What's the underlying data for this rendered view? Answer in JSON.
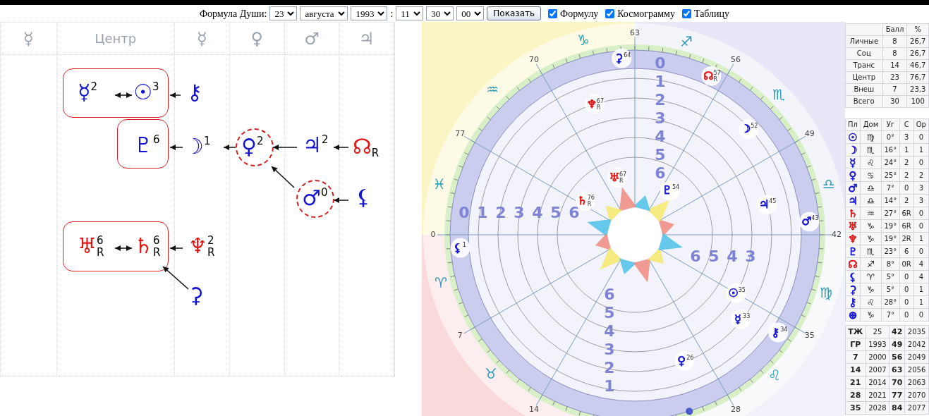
{
  "toolbar": {
    "label": "Формула Души:",
    "day": "23",
    "month": "августа",
    "year": "1993",
    "separator": ":",
    "hour": "11",
    "minute": "30",
    "second": "00",
    "button": "Показать",
    "checkboxes": [
      {
        "label": "Формулу",
        "checked": true
      },
      {
        "label": "Космограмму",
        "checked": true
      },
      {
        "label": "Таблицу",
        "checked": true
      }
    ]
  },
  "formula": {
    "columns": [
      {
        "label": "☿",
        "kind": "glyph"
      },
      {
        "label": "Центр",
        "kind": "text"
      },
      {
        "label": "☿",
        "kind": "glyph"
      },
      {
        "label": "♀",
        "kind": "glyph"
      },
      {
        "label": "♂",
        "kind": "glyph"
      },
      {
        "label": "♃",
        "kind": "glyph"
      }
    ],
    "groups": [
      {
        "nodes": [
          {
            "glyph": "☿",
            "sup": "2",
            "color": "#1414d2",
            "circled": false
          },
          {
            "glyph": "☉",
            "sup": "3",
            "color": "#1414d2",
            "circled": false
          }
        ]
      },
      {
        "nodes": [
          {
            "glyph": "♇",
            "sup": "6",
            "color": "#1414d2",
            "circled": false
          }
        ]
      },
      {
        "nodes": [
          {
            "glyph": "♅",
            "sup": "6",
            "sub": "R",
            "color": "#e31414",
            "circled": false
          },
          {
            "glyph": "♄",
            "sup": "6",
            "sub": "R",
            "color": "#e31414",
            "circled": false
          }
        ]
      }
    ],
    "nodes": [
      {
        "glyph": "⚷",
        "color": "#1414d2",
        "circled": false
      },
      {
        "glyph": "☽",
        "sup": "1",
        "color": "#1414d2",
        "circled": false
      },
      {
        "glyph": "♀",
        "sup": "2",
        "color": "#1414d2",
        "circled": true
      },
      {
        "glyph": "♃",
        "sup": "2",
        "color": "#1414d2",
        "circled": false
      },
      {
        "glyph": "☊",
        "sub": "R",
        "color": "#e31414",
        "circled": false
      },
      {
        "glyph": "♂",
        "sup": "0",
        "color": "#1414d2",
        "circled": true
      },
      {
        "glyph": "⚸",
        "color": "#1414d2",
        "circled": false
      },
      {
        "glyph": "♆",
        "sup": "2",
        "sub": "R",
        "color": "#e31414",
        "circled": false
      },
      {
        "glyph": "⚳",
        "color": "#1414d2",
        "circled": false
      }
    ]
  },
  "cosmogram": {
    "ages": [
      "0",
      "7",
      "14",
      "28",
      "35",
      "42",
      "49",
      "56",
      "63",
      "70",
      "77"
    ],
    "signs": [
      "♑",
      "♐",
      "♏",
      "♎",
      "♍",
      "♌",
      "♉",
      "♈",
      "♓",
      "♒"
    ],
    "scales": [
      {
        "labels": [
          "0",
          "1",
          "2",
          "3",
          "4",
          "5",
          "6"
        ]
      },
      {
        "labels": [
          "0",
          "1",
          "2",
          "3",
          "4",
          "5",
          "6"
        ]
      },
      {
        "labels": [
          "6",
          "5",
          "4",
          "3"
        ]
      },
      {
        "labels": [
          "6",
          "5",
          "4",
          "3",
          "2",
          "1"
        ]
      }
    ],
    "planets": [
      {
        "glyph": "⚳",
        "age": "64",
        "color": "#1414d2"
      },
      {
        "glyph": "☊",
        "age": "57",
        "retro": "R",
        "color": "#e31414"
      },
      {
        "glyph": "☽",
        "age": "52",
        "color": "#1414d2"
      },
      {
        "glyph": "♆",
        "age": "67",
        "retro": "R",
        "color": "#e31414"
      },
      {
        "glyph": "♅",
        "age": "67",
        "retro": "R",
        "color": "#e31414"
      },
      {
        "glyph": "♄",
        "age": "76",
        "retro": "R",
        "color": "#e31414"
      },
      {
        "glyph": "♇",
        "age": "54",
        "color": "#1414d2"
      },
      {
        "glyph": "♃",
        "age": "45",
        "color": "#1414d2"
      },
      {
        "glyph": "♂",
        "age": "43",
        "color": "#1414d2"
      },
      {
        "glyph": "⚸",
        "age": "1",
        "color": "#1414d2"
      },
      {
        "glyph": "☉",
        "age": "35",
        "color": "#1414d2"
      },
      {
        "glyph": "☿",
        "age": "33",
        "color": "#1414d2"
      },
      {
        "glyph": "⚷",
        "age": "34",
        "color": "#1414d2"
      },
      {
        "glyph": "♀",
        "age": "26",
        "color": "#1414d2"
      }
    ]
  },
  "scores": {
    "columns": [
      "",
      "Балл",
      "%"
    ],
    "rows": [
      [
        "Личные",
        "8",
        "26,7"
      ],
      [
        "Соц",
        "8",
        "26,7"
      ],
      [
        "Транс",
        "14",
        "46,7"
      ],
      [
        "Центр",
        "23",
        "76,7"
      ],
      [
        "Внеш",
        "7",
        "23,3"
      ],
      [
        "Всего",
        "30",
        "100"
      ]
    ]
  },
  "planets_table": {
    "columns": [
      "Пл",
      "Дом",
      "Уг",
      "С",
      "Ор"
    ],
    "rows": [
      {
        "glyph": "☉",
        "color": "#1414d2",
        "sign": "♍",
        "deg": "0°",
        "c": "3",
        "or": "0"
      },
      {
        "glyph": "☽",
        "color": "#1414d2",
        "sign": "♏",
        "deg": "16°",
        "c": "1",
        "or": "1"
      },
      {
        "glyph": "☿",
        "color": "#1414d2",
        "sign": "♌",
        "deg": "24°",
        "c": "2",
        "or": "0"
      },
      {
        "glyph": "♀",
        "color": "#1414d2",
        "sign": "♋",
        "deg": "25°",
        "c": "2",
        "or": "2"
      },
      {
        "glyph": "♂",
        "color": "#1414d2",
        "sign": "♎",
        "deg": "7°",
        "c": "0",
        "or": "3"
      },
      {
        "glyph": "♃",
        "color": "#1414d2",
        "sign": "♎",
        "deg": "14°",
        "c": "2",
        "or": "3"
      },
      {
        "glyph": "♄",
        "color": "#e31414",
        "sign": "♒",
        "deg": "27°",
        "c": "6R",
        "or": "0"
      },
      {
        "glyph": "♅",
        "color": "#e31414",
        "sign": "♑",
        "deg": "19°",
        "c": "6R",
        "or": "0"
      },
      {
        "glyph": "♆",
        "color": "#e31414",
        "sign": "♑",
        "deg": "19°",
        "c": "2R",
        "or": "1"
      },
      {
        "glyph": "♇",
        "color": "#1414d2",
        "sign": "♏",
        "deg": "23°",
        "c": "6",
        "or": "0"
      },
      {
        "glyph": "☊",
        "color": "#e31414",
        "sign": "♐",
        "deg": "8°",
        "c": "0R",
        "or": "4"
      },
      {
        "glyph": "⚸",
        "color": "#1414d2",
        "sign": "♈",
        "deg": "5°",
        "c": "0",
        "or": "4"
      },
      {
        "glyph": "⚳",
        "color": "#1414d2",
        "sign": "♑",
        "deg": "5°",
        "c": "0",
        "or": "1"
      },
      {
        "glyph": "⚷",
        "color": "#1414d2",
        "sign": "♌",
        "deg": "28°",
        "c": "0",
        "or": "1"
      },
      {
        "glyph": "⊕",
        "color": "#1414d2",
        "sign": "♑",
        "deg": "7°",
        "c": "0",
        "or": "0"
      }
    ]
  },
  "years_table": {
    "rows": [
      [
        "ТЖ",
        "25",
        "42",
        "2035"
      ],
      [
        "ГР",
        "1993",
        "49",
        "2042"
      ],
      [
        "7",
        "2000",
        "56",
        "2049"
      ],
      [
        "14",
        "2007",
        "63",
        "2056"
      ],
      [
        "21",
        "2014",
        "70",
        "2063"
      ],
      [
        "28",
        "2021",
        "77",
        "2070"
      ],
      [
        "35",
        "2028",
        "84",
        "2077"
      ]
    ]
  }
}
